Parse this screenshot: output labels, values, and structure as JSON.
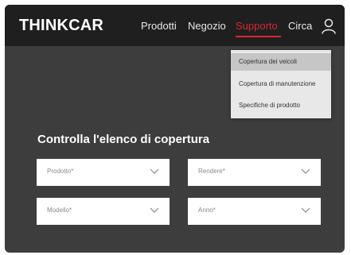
{
  "header": {
    "logo": "THINKCAR",
    "nav": [
      {
        "label": "Prodotti"
      },
      {
        "label": "Negozio"
      },
      {
        "label": "Supporto",
        "active": true
      },
      {
        "label": "Circa"
      }
    ],
    "user_icon": "user-icon",
    "accent_color": "#d9272e"
  },
  "dropdown": {
    "items": [
      {
        "label": "Copertura dei veicoli",
        "hover": true
      },
      {
        "label": "Copertura di manutenzione"
      },
      {
        "label": "Specifiche di prodotto"
      }
    ]
  },
  "main": {
    "title": "Controlla l'elenco di copertura",
    "fields": [
      {
        "placeholder": "Prodotto*"
      },
      {
        "placeholder": "Rendere*"
      },
      {
        "placeholder": "Modello*"
      },
      {
        "placeholder": "Anno*"
      }
    ],
    "chevron_icon": "chevron-down-icon"
  }
}
